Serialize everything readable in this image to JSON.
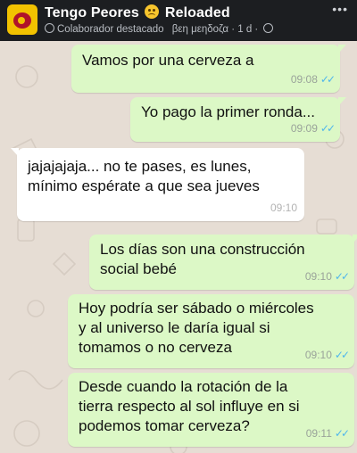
{
  "header": {
    "group_name": "Tengo Peores",
    "group_suffix": "Reloaded",
    "role": "Colaborador destacado",
    "author": "βεη μεηδοζα",
    "time": "1 d",
    "emoji_icon": "frowning-face-icon",
    "menu_icon": "more-options-icon"
  },
  "messages": [
    {
      "text": "Vamos por una cerveza a",
      "time": "09:08",
      "direction": "outgoing"
    },
    {
      "text": "Yo pago la primer ronda...",
      "time": "09:09",
      "direction": "outgoing"
    },
    {
      "line1": "jajajajaja... no te pases, es lunes,",
      "line2": "mínimo espérate a que sea jueves",
      "time": "09:10",
      "direction": "incoming"
    },
    {
      "line1": "Los días son una construcción",
      "line2": "social bebé",
      "time": "09:10",
      "direction": "outgoing"
    },
    {
      "line1": "Hoy podría ser sábado o miércoles",
      "line2": "y al universo le daría igual si",
      "line3": "tomamos o no cerveza",
      "time": "09:10",
      "direction": "outgoing"
    },
    {
      "line1": "Desde cuando la rotación de la",
      "line2": "tierra respecto al sol influye en si",
      "line3": "podemos tomar cerveza?",
      "time": "09:11",
      "direction": "outgoing"
    }
  ],
  "colors": {
    "outgoing_bubble": "#dcf8c6",
    "incoming_bubble": "#ffffff",
    "read_ticks": "#4fb6ec",
    "header_bg": "#1c1e21",
    "wallpaper": "#e6ddd4"
  }
}
